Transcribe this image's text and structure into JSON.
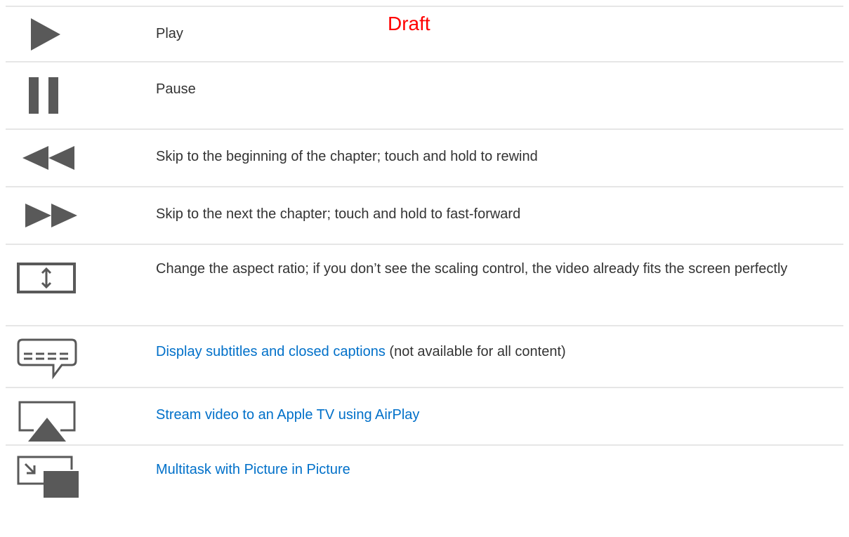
{
  "watermark": "Draft",
  "colors": {
    "icon": "#595959",
    "text": "#333333",
    "link": "#0070c9",
    "divider": "#e6e6e6",
    "watermark": "#ff0000"
  },
  "rows": [
    {
      "icon": "play-icon",
      "text": "Play"
    },
    {
      "icon": "pause-icon",
      "text": "Pause"
    },
    {
      "icon": "rewind-icon",
      "text": "Skip to the beginning of the chapter; touch and hold to rewind"
    },
    {
      "icon": "fast-forward-icon",
      "text": "Skip to the next the chapter; touch and hold to fast-forward"
    },
    {
      "icon": "aspect-ratio-icon",
      "text": "Change the aspect ratio; if you don’t see the scaling control, the video already fits the screen perfectly"
    },
    {
      "icon": "subtitles-icon",
      "link": "Display subtitles and closed captions",
      "text": " (not available for all content)"
    },
    {
      "icon": "airplay-icon",
      "link": "Stream video to an Apple TV using AirPlay"
    },
    {
      "icon": "picture-in-picture-icon",
      "link": "Multitask with Picture in Picture"
    }
  ]
}
